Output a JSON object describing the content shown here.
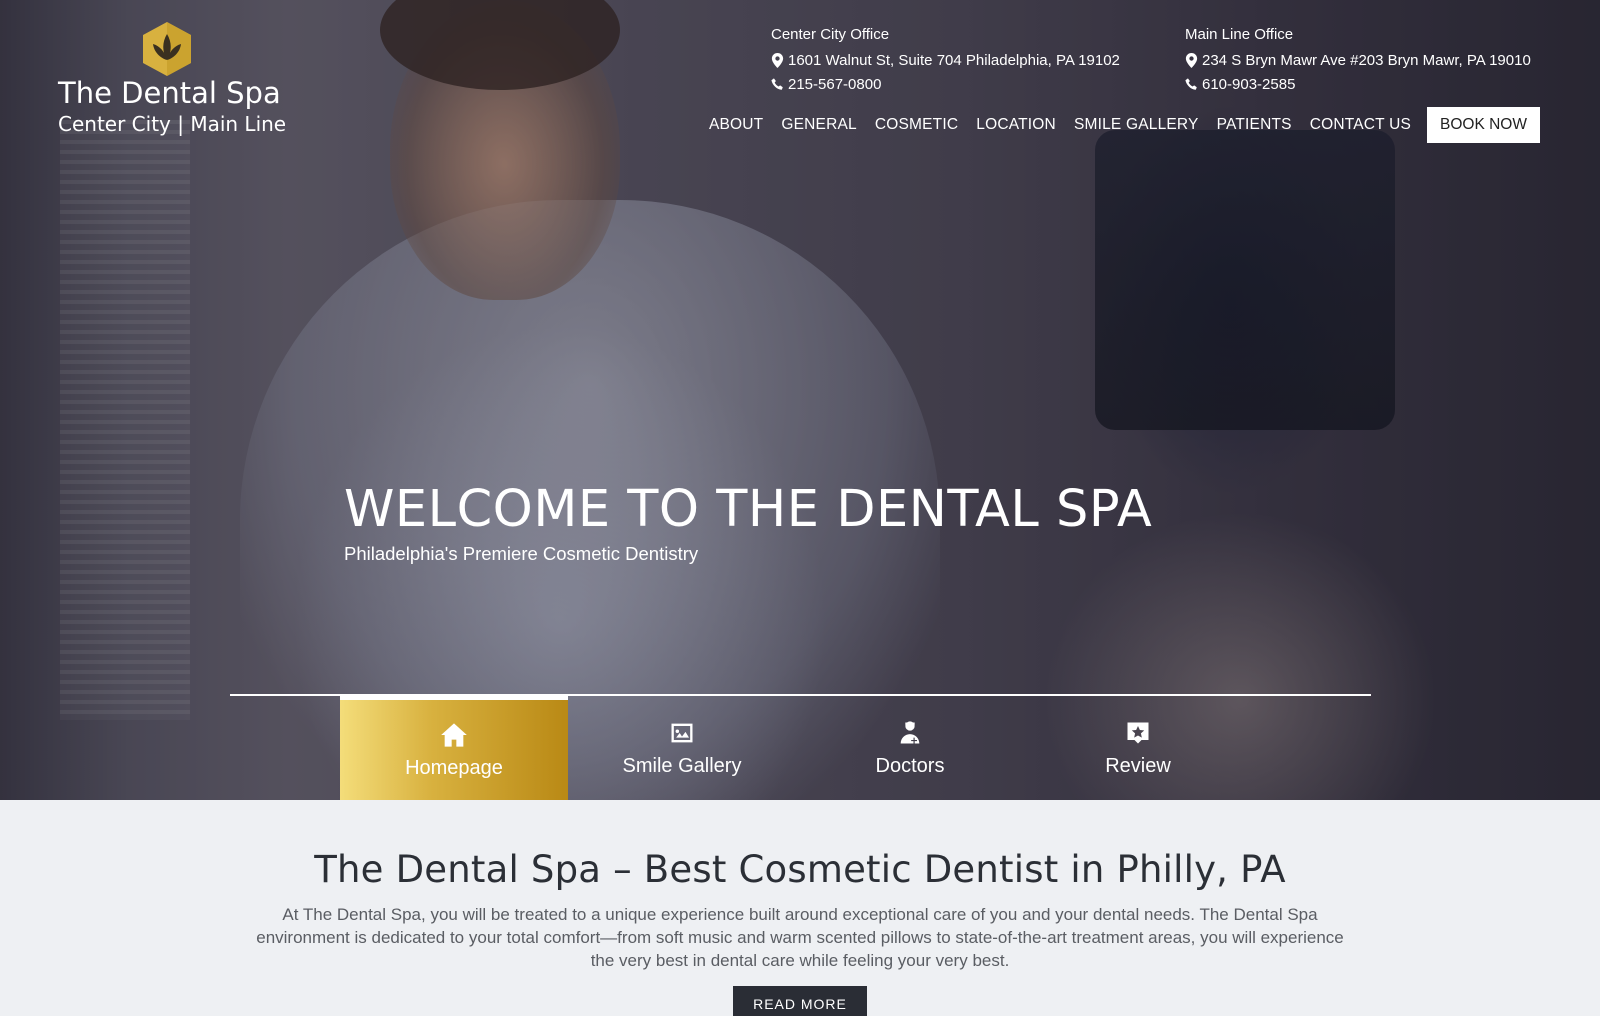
{
  "brand": {
    "title": "The Dental Spa",
    "subtitle": "Center City | Main Line",
    "gold": "#d8b13f"
  },
  "offices": [
    {
      "name": "Center City Office",
      "address": "1601 Walnut St, Suite 704 Philadelphia, PA 19102",
      "phone": "215-567-0800"
    },
    {
      "name": "Main Line Office",
      "address": "234 S Bryn Mawr Ave #203 Bryn Mawr, PA 19010",
      "phone": "610-903-2585"
    }
  ],
  "nav": {
    "items": [
      "ABOUT",
      "GENERAL",
      "COSMETIC",
      "LOCATION",
      "SMILE GALLERY",
      "PATIENTS",
      "CONTACT US"
    ],
    "book_label": "BOOK NOW"
  },
  "hero": {
    "heading": "WELCOME TO THE DENTAL SPA",
    "subheading": "Philadelphia's Premiere Cosmetic Dentistry"
  },
  "tabs": [
    {
      "label": "Homepage",
      "icon": "home-icon",
      "active": true
    },
    {
      "label": "Smile Gallery",
      "icon": "gallery-icon",
      "active": false
    },
    {
      "label": "Doctors",
      "icon": "doctor-icon",
      "active": false
    },
    {
      "label": "Review",
      "icon": "review-icon",
      "active": false
    }
  ],
  "intro": {
    "heading": "The Dental Spa – Best Cosmetic Dentist in Philly, PA",
    "body": "At The Dental Spa, you will be treated to a unique experience built around exceptional care of you and your dental needs. The Dental Spa environment is dedicated to your total comfort—from soft music and warm scented pillows to state-of-the-art treatment areas, you will experience the very best in dental care while feeling your very best.",
    "button_label": "READ MORE"
  }
}
